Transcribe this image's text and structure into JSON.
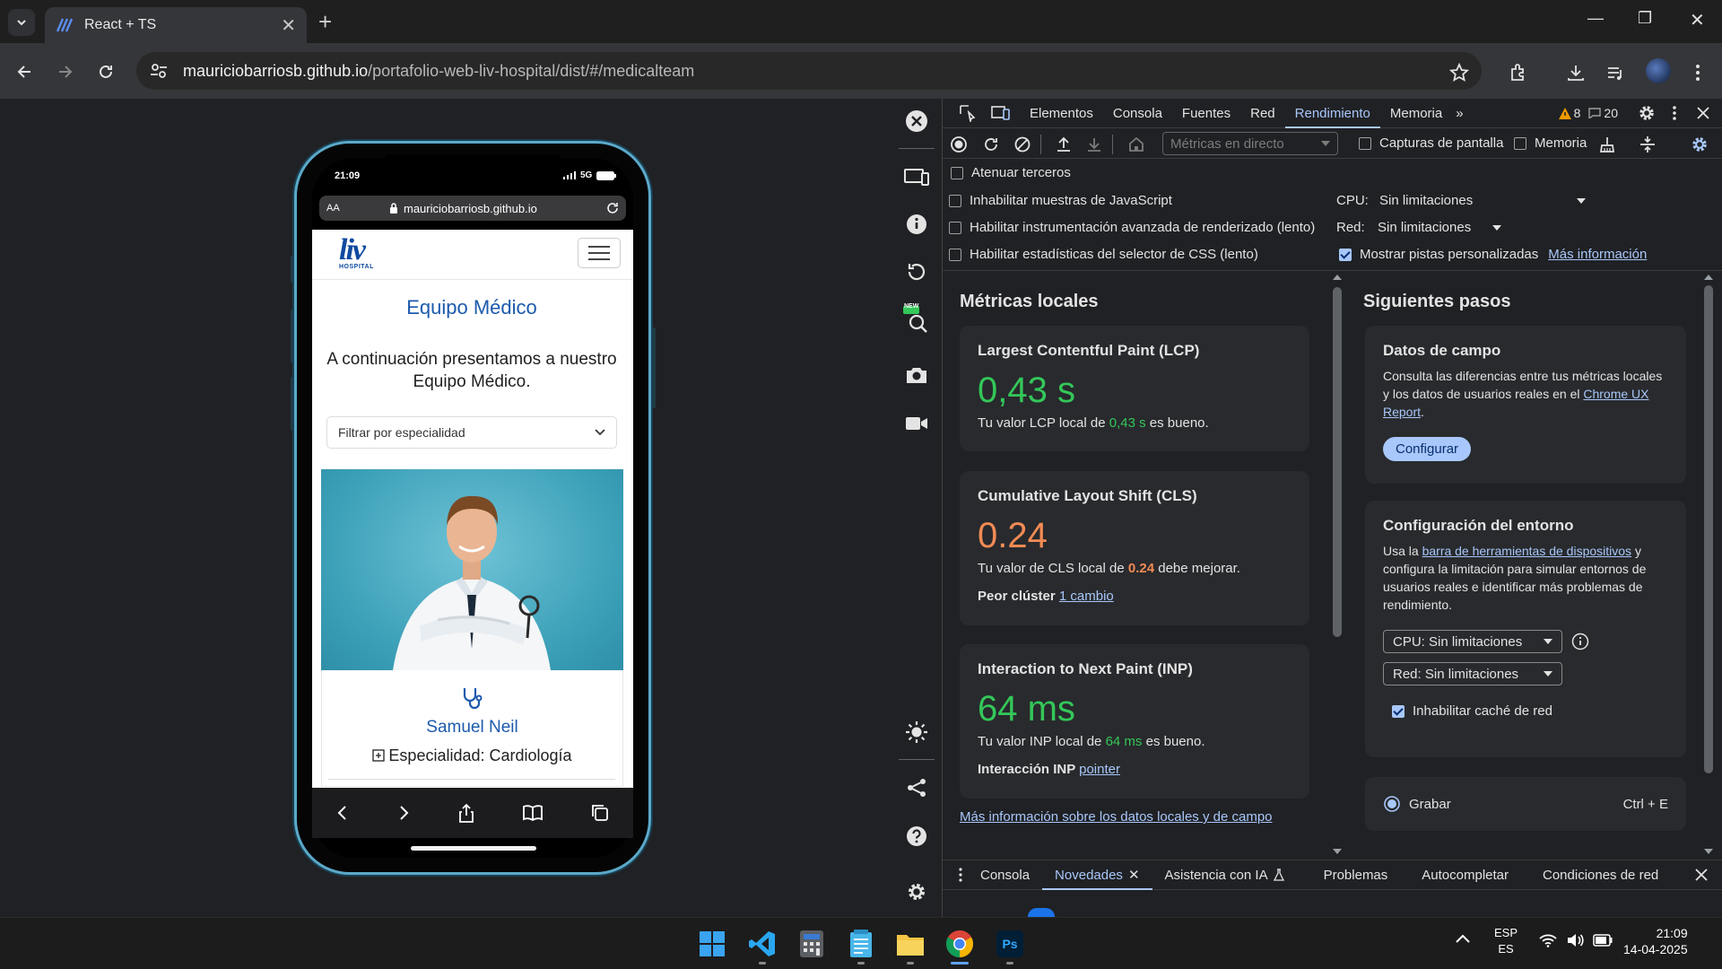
{
  "browser": {
    "tab_title": "React + TS",
    "url_host": "mauriciobarriosb.github.io",
    "url_path": "/portafolio-web-liv-hospital/dist/#/medicalteam"
  },
  "phone": {
    "time": "21:09",
    "network": "5G",
    "aa": "AA",
    "url": "mauriciobarriosb.github.io",
    "logo_text": "liv",
    "logo_sub": "HOSPITAL",
    "page_title": "Equipo Médico",
    "intro": "A continuación presentamos a nuestro Equipo Médico.",
    "filter_placeholder": "Filtrar por especialidad",
    "doctor_name": "Samuel Neil",
    "doctor_specialty": "Especialidad: Cardiología"
  },
  "devtools": {
    "tabs": [
      "Elementos",
      "Consola",
      "Fuentes",
      "Red",
      "Rendimiento",
      "Memoria"
    ],
    "active_tab": "Rendimiento",
    "more_tabs": "»",
    "warnings": "8",
    "messages": "20",
    "metric_select": "Métricas en directo",
    "screenshots_label": "Capturas de pantalla",
    "memory_label": "Memoria",
    "dim_third": "Atenuar terceros",
    "opt_js": "Inhabilitar muestras de JavaScript",
    "opt_render": "Habilitar instrumentación avanzada de renderizado (lento)",
    "opt_css": "Habilitar estadísticas del selector de CSS (lento)",
    "cpu_label": "CPU:",
    "cpu_value": "Sin limitaciones",
    "net_label": "Red:",
    "net_value": "Sin limitaciones",
    "custom_tracks": "Mostrar pistas personalizadas",
    "more_info": "Más información",
    "local_metrics_title": "Métricas locales",
    "lcp": {
      "title": "Largest Contentful Paint (LCP)",
      "value": "0,43 s",
      "desc_pre": "Tu valor LCP local de",
      "desc_val": "0,43 s",
      "desc_post": "es bueno."
    },
    "cls": {
      "title": "Cumulative Layout Shift (CLS)",
      "value": "0.24",
      "desc_pre": "Tu valor de CLS local de",
      "desc_val": "0.24",
      "desc_post": "debe mejorar.",
      "cluster_label": "Peor clúster",
      "cluster_link": "1 cambio"
    },
    "inp": {
      "title": "Interaction to Next Paint (INP)",
      "value": "64 ms",
      "desc_pre": "Tu valor INP local de",
      "desc_val": "64 ms",
      "desc_post": "es bueno.",
      "interaction_label": "Interacción INP",
      "interaction_link": "pointer"
    },
    "more_local_link": "Más información sobre los datos locales y de campo",
    "next_steps_title": "Siguientes pasos",
    "field": {
      "title": "Datos de campo",
      "desc": "Consulta las diferencias entre tus métricas locales y los datos de usuarios reales en el",
      "link": "Chrome UX Report",
      "button": "Configurar"
    },
    "env": {
      "title": "Configuración del entorno",
      "desc_pre": "Usa la",
      "desc_link": "barra de herramientas de dispositivos",
      "desc_post": "y configura la limitación para simular entornos de usuarios reales e identificar más problemas de rendimiento.",
      "cpu_select": "CPU: Sin limitaciones",
      "net_select": "Red: Sin limitaciones",
      "cache_label": "Inhabilitar caché de red"
    },
    "record_label": "Grabar",
    "record_shortcut": "Ctrl + E",
    "drawer_tabs": [
      "Consola",
      "Novedades",
      "Asistencia con IA",
      "Problemas",
      "Autocompletar",
      "Condiciones de red"
    ],
    "drawer_active": "Novedades"
  },
  "side_new_badge": "NEW",
  "taskbar": {
    "lang_1": "ESP",
    "lang_2": "ES",
    "time": "21:09",
    "date": "14-04-2025"
  },
  "colors": {
    "good": "#34c759",
    "needs_improvement": "#f28b54",
    "accent": "#a8c7fa",
    "phone_frame": "#5ba9c9",
    "site_blue": "#1c5aad"
  }
}
